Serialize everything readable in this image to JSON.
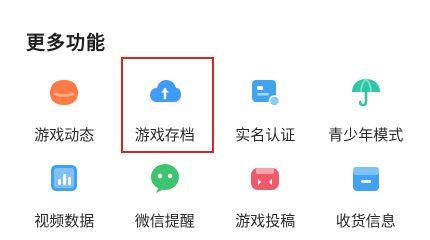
{
  "section": {
    "title": "更多功能"
  },
  "features": [
    {
      "label": "游戏动态",
      "icon": "game-news-icon",
      "color": "#ff7a45"
    },
    {
      "label": "游戏存档",
      "icon": "cloud-save-icon",
      "color": "#3f9bf5"
    },
    {
      "label": "实名认证",
      "icon": "id-card-icon",
      "color": "#41a4f0"
    },
    {
      "label": "青少年模式",
      "icon": "umbrella-icon",
      "color": "#2cc8a7"
    },
    {
      "label": "视频数据",
      "icon": "video-data-icon",
      "color": "#3fa2f3"
    },
    {
      "label": "微信提醒",
      "icon": "wechat-bubble-icon",
      "color": "#3cc56d"
    },
    {
      "label": "游戏投稿",
      "icon": "gamepad-icon",
      "color": "#ef5a6a"
    },
    {
      "label": "收货信息",
      "icon": "delivery-box-icon",
      "color": "#3fa2f3"
    }
  ],
  "highlight": {
    "target": "游戏存档",
    "color": "#d52525"
  }
}
